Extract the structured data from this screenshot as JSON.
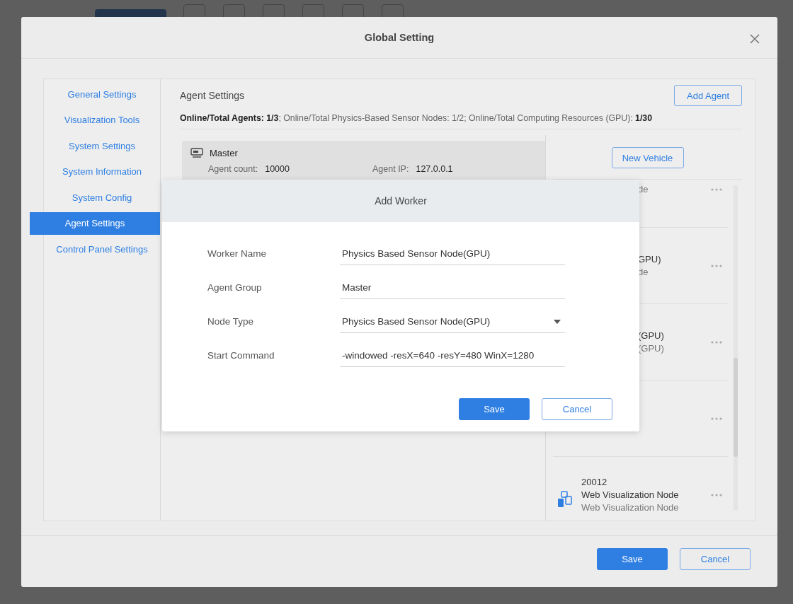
{
  "dialog": {
    "title": "Global Setting",
    "buttons": [
      "Save",
      "Cancel"
    ]
  },
  "sidebar": {
    "items": [
      {
        "label": "General Settings",
        "selected": false
      },
      {
        "label": "Visualization Tools",
        "selected": false
      },
      {
        "label": "System Settings",
        "selected": false
      },
      {
        "label": "System Information",
        "selected": false
      },
      {
        "label": "System Config",
        "selected": false
      },
      {
        "label": "Agent Settings",
        "selected": true
      },
      {
        "label": "Control Panel Settings",
        "selected": false
      }
    ]
  },
  "agent_settings": {
    "title": "Agent Settings",
    "add_button": "Add Agent",
    "stats": "**Online/Total Agents: 1/3**; Online/Total Physics-Based Sensor Nodes: 1/2; Online/Total Computing Resources (GPU): **1/30**",
    "master": {
      "name": "Master",
      "fields": [
        {
          "label": "Agent count:",
          "value": "10000"
        },
        {
          "label": "Agent IP:",
          "value": "127.0.0.1"
        }
      ]
    },
    "new_vehicle_button": "New Vehicle",
    "workers": [
      {
        "kind": "partial",
        "lines": [
          "de"
        ]
      },
      {
        "kind": "partial",
        "lines": [
          "GPU)",
          "de"
        ]
      },
      {
        "kind": "partial",
        "lines": [
          "(GPU)",
          "(GPU)"
        ]
      },
      {
        "kind": "partial"
      },
      {
        "kind": "full",
        "lines": [
          "20012",
          "Web Visualization Node",
          "Web Visualization Node"
        ]
      }
    ]
  },
  "add_worker": {
    "title": "Add Worker",
    "fields": [
      {
        "kind": "text",
        "label": "Worker Name",
        "value": "Physics Based Sensor Node(GPU)"
      },
      {
        "kind": "text",
        "label": "Agent Group",
        "value": "Master"
      },
      {
        "kind": "select",
        "label": "Node Type",
        "value": "Physics Based Sensor Node(GPU)"
      },
      {
        "kind": "text",
        "label": "Start Command",
        "value": "-windowed -resX=640 -resY=480 WinX=1280"
      }
    ],
    "buttons": [
      "Save",
      "Cancel"
    ]
  }
}
